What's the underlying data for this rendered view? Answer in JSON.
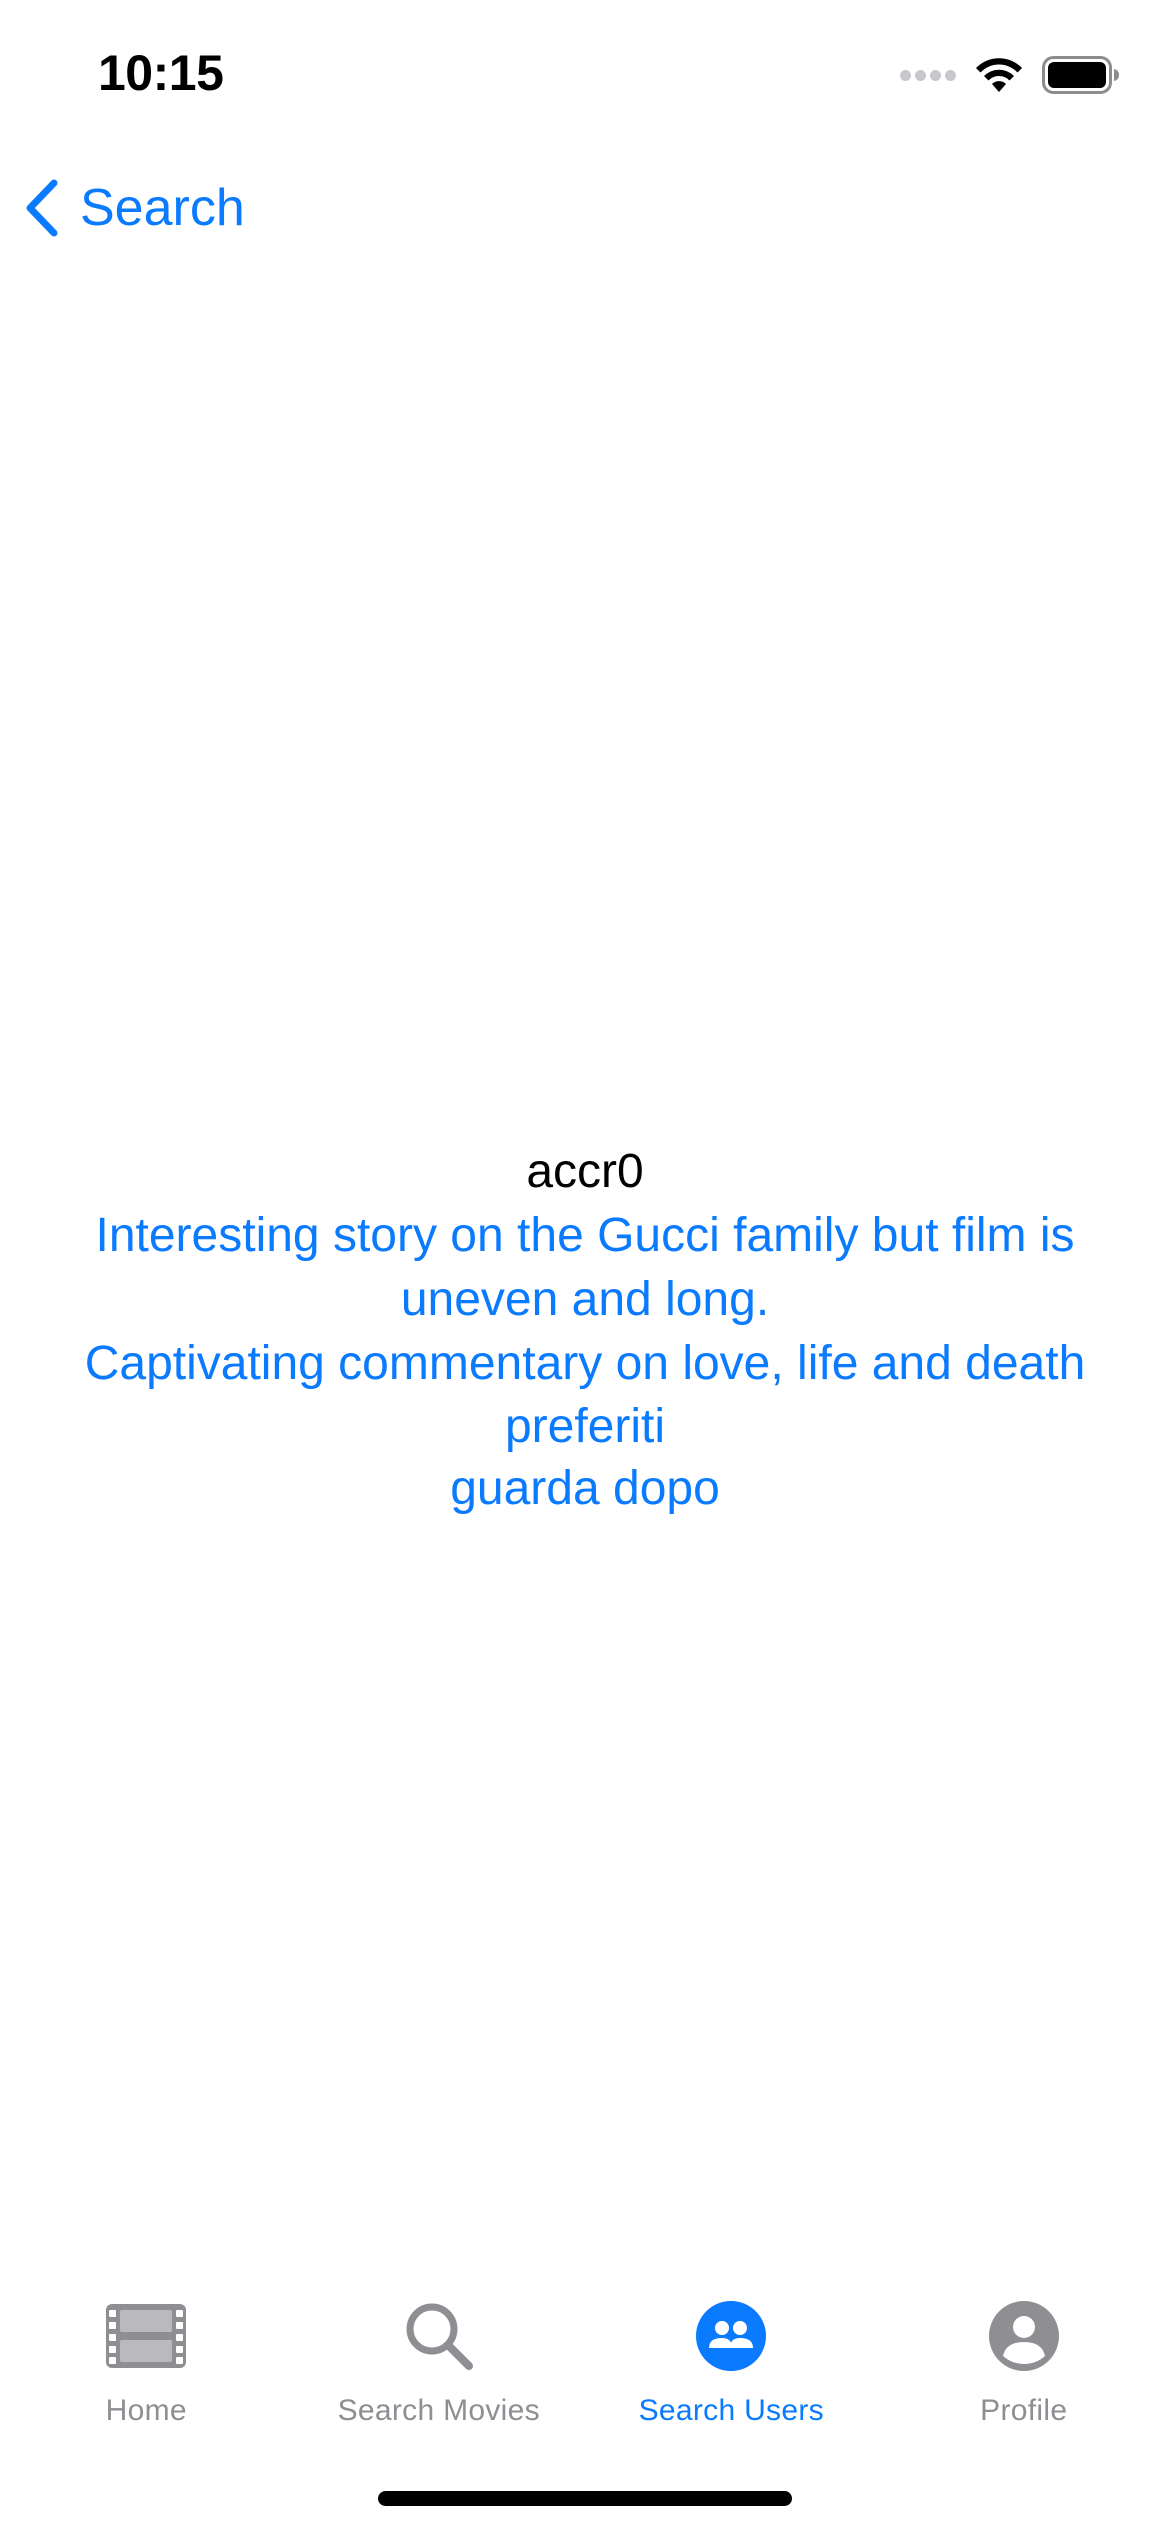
{
  "status_bar": {
    "time": "10:15"
  },
  "nav": {
    "back_label": "Search"
  },
  "profile": {
    "username": "accr0",
    "reviews": [
      "Interesting story on the Gucci family but film is uneven and long.",
      "Captivating commentary on love, life and death"
    ],
    "lists": [
      "preferiti",
      "guarda dopo"
    ]
  },
  "tab_bar": {
    "tabs": [
      {
        "label": "Home",
        "icon": "film-icon",
        "active": false
      },
      {
        "label": "Search Movies",
        "icon": "magnifier-icon",
        "active": false
      },
      {
        "label": "Search Users",
        "icon": "users-icon",
        "active": true
      },
      {
        "label": "Profile",
        "icon": "person-icon",
        "active": false
      }
    ]
  },
  "colors": {
    "accent": "#0a7aff",
    "inactive": "#8e8e93"
  }
}
